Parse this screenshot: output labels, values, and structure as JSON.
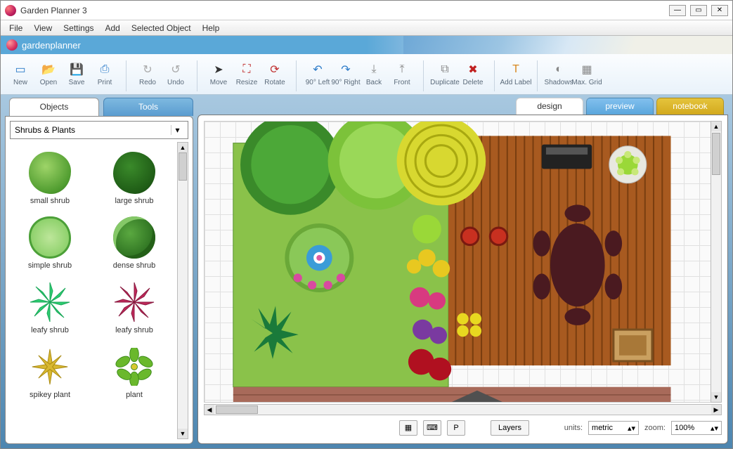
{
  "window": {
    "title": "Garden Planner 3"
  },
  "menu": [
    "File",
    "View",
    "Settings",
    "Add",
    "Selected Object",
    "Help"
  ],
  "banner": {
    "brand": "gardenplanner"
  },
  "toolbar": {
    "new": "New",
    "open": "Open",
    "save": "Save",
    "print": "Print",
    "redo": "Redo",
    "undo": "Undo",
    "move": "Move",
    "resize": "Resize",
    "rotate": "Rotate",
    "left90": "90° Left",
    "right90": "90° Right",
    "back": "Back",
    "front": "Front",
    "duplicate": "Duplicate",
    "delete": "Delete",
    "addlabel": "Add Label",
    "shadows": "Shadows",
    "maxgrid": "Max. Grid"
  },
  "sidebar": {
    "tab_objects": "Objects",
    "tab_tools": "Tools",
    "category": "Shrubs & Plants",
    "items": [
      {
        "label": "small shrub"
      },
      {
        "label": "large shrub"
      },
      {
        "label": "simple shrub"
      },
      {
        "label": "dense shrub"
      },
      {
        "label": "leafy shrub"
      },
      {
        "label": "leafy shrub"
      },
      {
        "label": "spikey plant"
      },
      {
        "label": "plant"
      }
    ]
  },
  "canvas": {
    "tab_design": "design",
    "tab_preview": "preview",
    "tab_notebook": "notebook"
  },
  "status": {
    "layers": "Layers",
    "units_label": "units:",
    "units_value": "metric",
    "zoom_label": "zoom:",
    "zoom_value": "100%",
    "p_button": "P"
  }
}
